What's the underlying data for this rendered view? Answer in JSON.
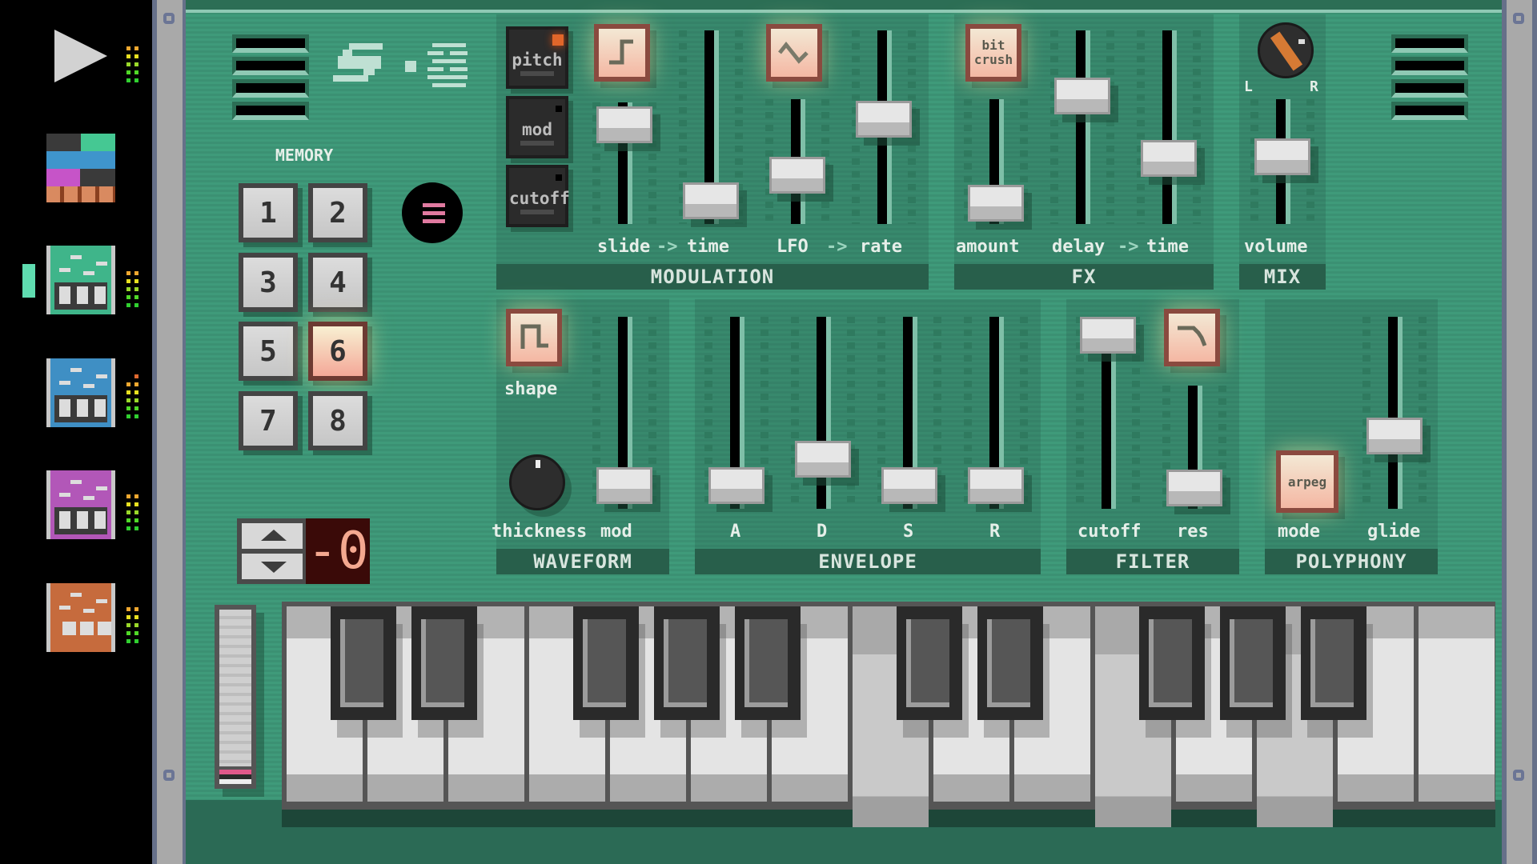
{
  "sidebar": {
    "play_button": "play-icon",
    "instruments": [
      {
        "name": "song-arranger",
        "color": "#multi"
      },
      {
        "name": "synth-teal",
        "color": "#3fb58a",
        "selected": true
      },
      {
        "name": "synth-blue",
        "color": "#3f8fc4"
      },
      {
        "name": "synth-purple",
        "color": "#b257b8"
      },
      {
        "name": "drum-machine-orange",
        "color": "#c66b3d"
      }
    ]
  },
  "header": {
    "logo_text": "S·≡"
  },
  "memory": {
    "title": "MEMORY",
    "slots": [
      "1",
      "2",
      "3",
      "4",
      "5",
      "6",
      "7",
      "8"
    ],
    "active_slot": "6",
    "menu_icon": "menu-icon"
  },
  "octave": {
    "display": "-0",
    "up_icon": "arrow-up-icon",
    "down_icon": "arrow-down-icon"
  },
  "modulation": {
    "targets": [
      "pitch",
      "mod",
      "cutoff"
    ],
    "active_target": "pitch",
    "labels": {
      "slide": "slide",
      "time1": "time",
      "lfo": "LFO",
      "rate": "rate"
    },
    "arrow": "->",
    "section": "MODULATION",
    "slide_level": 0.95,
    "time_level": 0.03,
    "lfo_level": 0.35,
    "rate_level": 0.55
  },
  "fx": {
    "bitcrush_label_1": "bit",
    "bitcrush_label_2": "crush",
    "labels": {
      "amount": "amount",
      "delay": "delay",
      "time": "time"
    },
    "arrow": "->",
    "section": "FX",
    "amount_level": 0.03,
    "delay_level": 0.7,
    "time_level": 0.3
  },
  "mix": {
    "pan_left": "L",
    "pan_right": "R",
    "volume_label": "volume",
    "section": "MIX",
    "volume_level": 0.55
  },
  "waveform": {
    "shape_label": "shape",
    "thickness_label": "thickness",
    "mod_label": "mod",
    "section": "WAVEFORM",
    "mod_level": 0.03
  },
  "envelope": {
    "labels": [
      "A",
      "D",
      "S",
      "R"
    ],
    "levels": [
      0.03,
      0.2,
      0.03,
      0.03
    ],
    "section": "ENVELOPE"
  },
  "filter": {
    "cutoff_label": "cutoff",
    "res_label": "res",
    "section": "FILTER",
    "cutoff_level": 1.0,
    "res_level": 0.03
  },
  "polyphony": {
    "mode_button": "arpeg",
    "mode_label": "mode",
    "glide_label": "glide",
    "section": "POLYPHONY",
    "glide_level": 0.35
  },
  "keyboard": {
    "white_keys": 15,
    "pressed_white_keys": [
      7,
      10,
      12
    ]
  }
}
